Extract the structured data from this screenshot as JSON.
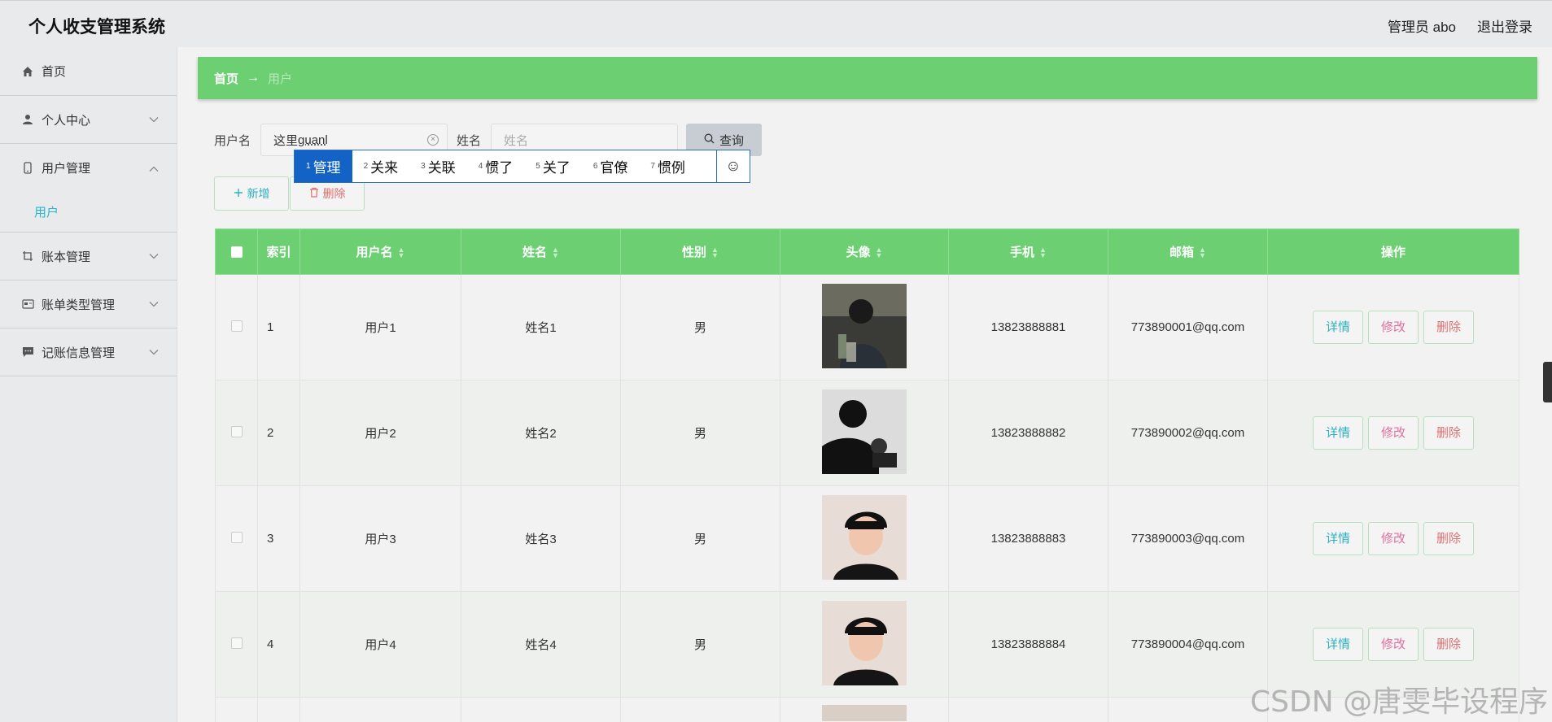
{
  "header": {
    "title": "个人收支管理系统",
    "admin_label": "管理员 abo",
    "logout_label": "退出登录"
  },
  "sidebar": {
    "home": "首页",
    "personal_center": "个人中心",
    "user_mgmt": "用户管理",
    "user_sub": "用户",
    "ledger_mgmt": "账本管理",
    "bill_type_mgmt": "账单类型管理",
    "record_mgmt": "记账信息管理"
  },
  "breadcrumb": {
    "home": "首页",
    "separator": "→",
    "current": "用户"
  },
  "search": {
    "username_label": "用户名",
    "username_value_plain": "这里",
    "username_value_composing": "guanl",
    "name_label": "姓名",
    "name_placeholder": "姓名",
    "query_label": "查询"
  },
  "ime": {
    "candidates": [
      {
        "num": "1",
        "text": "管理"
      },
      {
        "num": "2",
        "text": "关来"
      },
      {
        "num": "3",
        "text": "关联"
      },
      {
        "num": "4",
        "text": "惯了"
      },
      {
        "num": "5",
        "text": "关了"
      },
      {
        "num": "6",
        "text": "官僚"
      },
      {
        "num": "7",
        "text": "惯例"
      }
    ],
    "emoji": "☺"
  },
  "actions": {
    "add_label": "新增",
    "delete_label": "删除"
  },
  "table": {
    "headers": {
      "index": "索引",
      "username": "用户名",
      "name": "姓名",
      "gender": "性别",
      "avatar": "头像",
      "phone": "手机",
      "email": "邮箱",
      "ops": "操作"
    },
    "rows": [
      {
        "index": "1",
        "username": "用户1",
        "name": "姓名1",
        "gender": "男",
        "phone": "13823888881",
        "email": "773890001@qq.com"
      },
      {
        "index": "2",
        "username": "用户2",
        "name": "姓名2",
        "gender": "男",
        "phone": "13823888882",
        "email": "773890002@qq.com"
      },
      {
        "index": "3",
        "username": "用户3",
        "name": "姓名3",
        "gender": "男",
        "phone": "13823888883",
        "email": "773890003@qq.com"
      },
      {
        "index": "4",
        "username": "用户4",
        "name": "姓名4",
        "gender": "男",
        "phone": "13823888884",
        "email": "773890004@qq.com"
      }
    ],
    "op_labels": {
      "detail": "详情",
      "edit": "修改",
      "delete": "删除"
    }
  },
  "watermark": "CSDN @唐雯毕设程序",
  "colors": {
    "accent_green": "#6cd073",
    "link_teal": "#27b6c9",
    "danger": "#e06f6f",
    "ime_blue": "#1363c7"
  }
}
